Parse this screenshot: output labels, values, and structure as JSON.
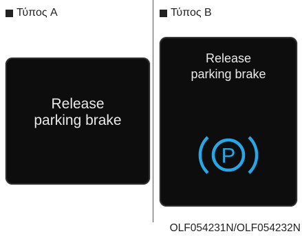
{
  "panels": {
    "a": {
      "label": "Τύπος A",
      "message_line1": "Release",
      "message_line2": "parking brake"
    },
    "b": {
      "label": "Τύπος B",
      "message_line1": "Release",
      "message_line2": "parking brake",
      "icon": "parking-brake-icon",
      "icon_glyph": "P",
      "icon_color": "#29a6e6"
    }
  },
  "caption": "OLF054231N/OLF054232N"
}
